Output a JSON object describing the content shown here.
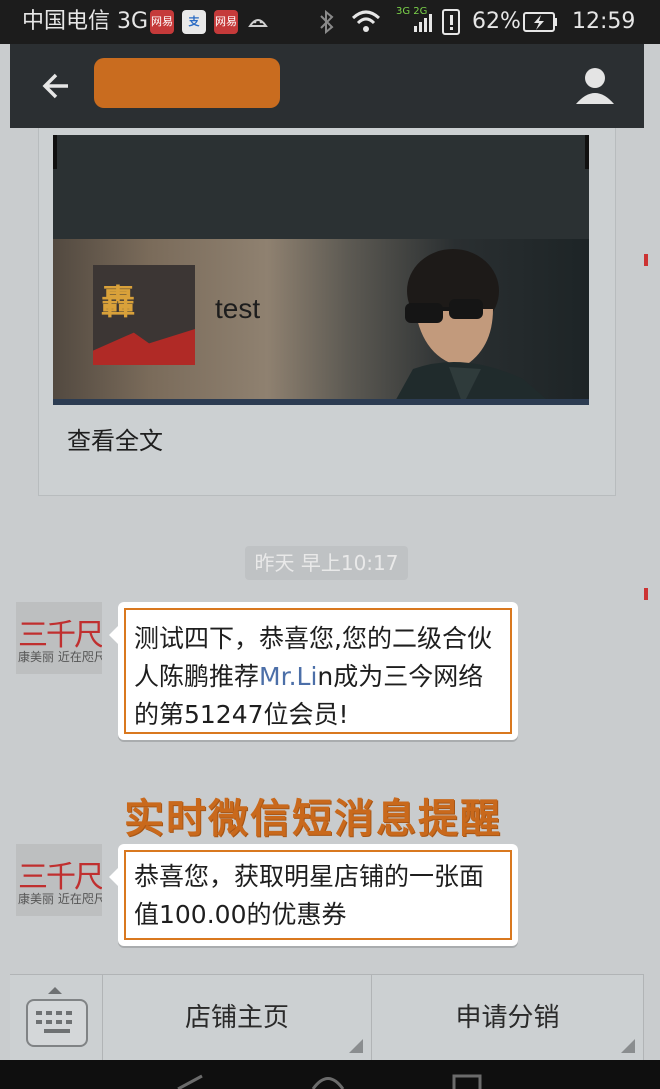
{
  "status_bar": {
    "carrier": "中国电信 3G",
    "notification_icons": [
      "app-badge-icon",
      "alipay-icon",
      "app-badge-icon",
      "android-icon"
    ],
    "badge_text": "网易",
    "alipay_text": "支",
    "battery": "62%",
    "time": "12:59",
    "network": "3G 2G"
  },
  "header": {
    "back_icon": "arrow-left-icon",
    "title_color": "#c96c1f",
    "profile_icon": "user-icon"
  },
  "article": {
    "logo_mark": "轟",
    "title": "test",
    "read_more": "查看全文"
  },
  "timestamp": "昨天 早上10:17",
  "avatar": {
    "brand": "三千尺",
    "tagline": "康美丽 近在咫尺"
  },
  "messages": [
    {
      "before_link": "测试四下，恭喜您,您的二级合伙人陈鹏推荐",
      "link": "Mr.Li",
      "after_link": "n成为三今网络的第51247位会员!"
    },
    {
      "text": "恭喜您，获取明星店铺的一张面值100.00的优惠券"
    }
  ],
  "promo_banner": "实时微信短消息提醒",
  "bottom_menu": {
    "keyboard_icon": "keyboard-icon",
    "items": [
      {
        "label": "店铺主页"
      },
      {
        "label": "申请分销"
      }
    ]
  },
  "colors": {
    "accent": "#c96c1f",
    "link": "#4c6fa8",
    "header_bg": "#2b2f32"
  }
}
